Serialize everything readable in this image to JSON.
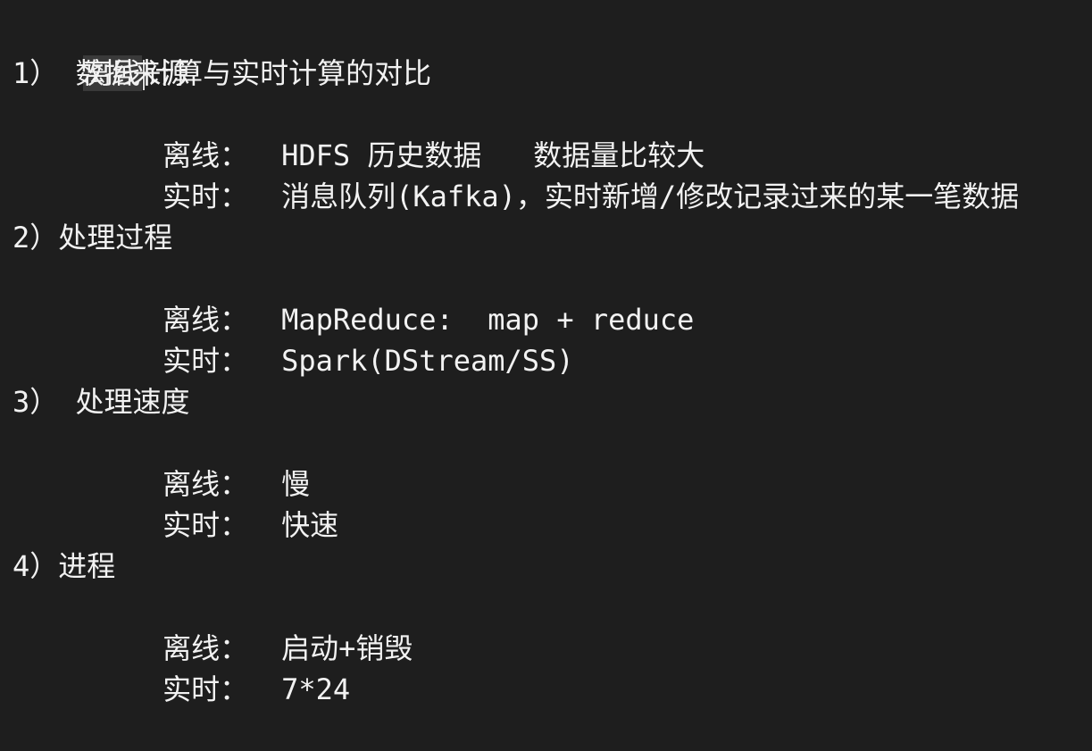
{
  "document": {
    "title_selected": "离线",
    "title_rest": "计算与实时计算的对比",
    "sections": [
      {
        "heading": "1） 数据来源",
        "offline_label": "离线：",
        "offline_value": "HDFS 历史数据   数据量比较大",
        "realtime_label": "实时：",
        "realtime_value": "消息队列(Kafka)，实时新增/修改记录过来的某一笔数据"
      },
      {
        "heading": "2）处理过程",
        "offline_label": "离线：",
        "offline_value": "MapReduce:  map + reduce",
        "realtime_label": "实时：",
        "realtime_value": "Spark(DStream/SS)"
      },
      {
        "heading": "3） 处理速度",
        "offline_label": "离线：",
        "offline_value": "慢",
        "realtime_label": "实时：",
        "realtime_value": "快速"
      },
      {
        "heading": "4）进程",
        "offline_label": "离线：",
        "offline_value": "启动+销毁",
        "realtime_label": "实时：",
        "realtime_value": "7*24"
      }
    ]
  }
}
